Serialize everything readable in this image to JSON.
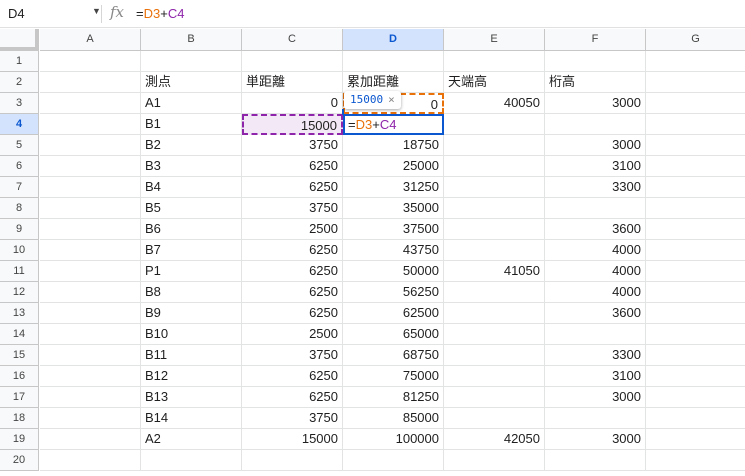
{
  "name_box": {
    "value": "D4"
  },
  "formula_bar": {
    "fx_label": "fx",
    "ref1": "D3",
    "op": "+",
    "ref2": "C4",
    "eq": "="
  },
  "columns": [
    "A",
    "B",
    "C",
    "D",
    "E",
    "F",
    "G"
  ],
  "selected_column": "D",
  "selected_row": "4",
  "rows": [
    {
      "n": "1",
      "B": "",
      "C": "",
      "D": "",
      "E": "",
      "F": ""
    },
    {
      "n": "2",
      "B": "測点",
      "C": "単距離",
      "D": "累加距離",
      "E": "天端高",
      "F": "桁高"
    },
    {
      "n": "3",
      "B": "A1",
      "C": "0",
      "D": "0",
      "E": "40050",
      "F": "3000"
    },
    {
      "n": "4",
      "B": "B1",
      "C": "15000",
      "D": "",
      "E": "",
      "F": ""
    },
    {
      "n": "5",
      "B": "B2",
      "C": "3750",
      "D": "18750",
      "E": "",
      "F": "3000"
    },
    {
      "n": "6",
      "B": "B3",
      "C": "6250",
      "D": "25000",
      "E": "",
      "F": "3100"
    },
    {
      "n": "7",
      "B": "B4",
      "C": "6250",
      "D": "31250",
      "E": "",
      "F": "3300"
    },
    {
      "n": "8",
      "B": "B5",
      "C": "3750",
      "D": "35000",
      "E": "",
      "F": ""
    },
    {
      "n": "9",
      "B": "B6",
      "C": "2500",
      "D": "37500",
      "E": "",
      "F": "3600"
    },
    {
      "n": "10",
      "B": "B7",
      "C": "6250",
      "D": "43750",
      "E": "",
      "F": "4000"
    },
    {
      "n": "11",
      "B": "P1",
      "C": "6250",
      "D": "50000",
      "E": "41050",
      "F": "4000"
    },
    {
      "n": "12",
      "B": "B8",
      "C": "6250",
      "D": "56250",
      "E": "",
      "F": "4000"
    },
    {
      "n": "13",
      "B": "B9",
      "C": "6250",
      "D": "62500",
      "E": "",
      "F": "3600"
    },
    {
      "n": "14",
      "B": "B10",
      "C": "2500",
      "D": "65000",
      "E": "",
      "F": ""
    },
    {
      "n": "15",
      "B": "B11",
      "C": "3750",
      "D": "68750",
      "E": "",
      "F": "3300"
    },
    {
      "n": "16",
      "B": "B12",
      "C": "6250",
      "D": "75000",
      "E": "",
      "F": "3100"
    },
    {
      "n": "17",
      "B": "B13",
      "C": "6250",
      "D": "81250",
      "E": "",
      "F": "3000"
    },
    {
      "n": "18",
      "B": "B14",
      "C": "3750",
      "D": "85000",
      "E": "",
      "F": ""
    },
    {
      "n": "19",
      "B": "A2",
      "C": "15000",
      "D": "100000",
      "E": "42050",
      "F": "3000"
    },
    {
      "n": "20",
      "B": "",
      "C": "",
      "D": "",
      "E": "",
      "F": ""
    }
  ],
  "active_edit": {
    "eq": "=",
    "ref1": "D3",
    "op": "+",
    "ref2": "C4"
  },
  "preview_tooltip": {
    "value": "15000",
    "close": "×"
  }
}
